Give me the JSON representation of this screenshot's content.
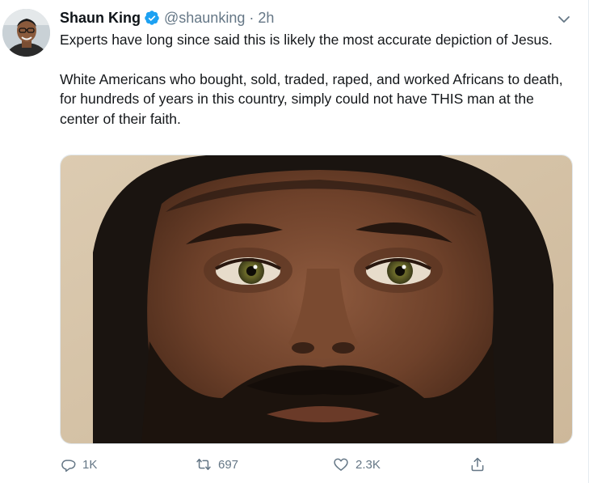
{
  "tweet": {
    "author_name": "Shaun King",
    "handle": "@shaunking",
    "separator": "·",
    "time": "2h",
    "paragraphs": [
      "Experts have long since said this is likely the most accurate depiction of Jesus.",
      "White Americans who bought, sold, traded, raped, and worked Africans to death, for hundreds of years in this country, simply could not have THIS man at the center of their faith."
    ],
    "media": {
      "description_icon": "portrait-image"
    },
    "actions": {
      "replies": "1K",
      "retweets": "697",
      "likes": "2.3K"
    }
  },
  "colors": {
    "verified": "#1da1f2",
    "secondary_text": "#657786",
    "primary_text": "#14171a"
  }
}
